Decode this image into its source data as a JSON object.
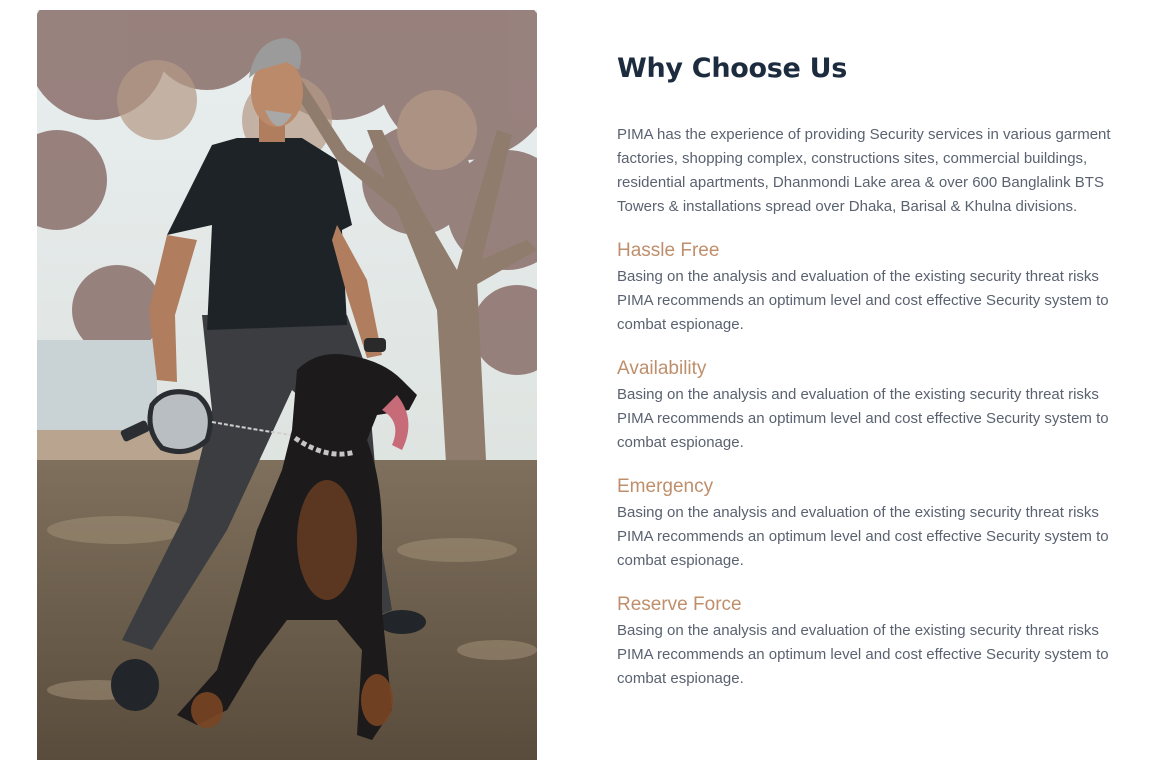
{
  "section": {
    "title": "Why Choose Us",
    "intro": "PIMA has the experience of providing Security services in various garment factories, shopping complex, constructions sites, commercial buildings, residential apartments, Dhanmondi Lake area & over 600 Banglalink BTS Towers & installations spread over Dhaka, Barisal & Khulna divisions."
  },
  "features": [
    {
      "title": "Hassle Free",
      "text": "Basing on the analysis and evaluation of the existing security threat risks PIMA recommends an optimum level and cost effective Security system to combat espionage."
    },
    {
      "title": "Availability",
      "text": "Basing on the analysis and evaluation of the existing security threat risks PIMA recommends an optimum level and cost effective Security system to combat espionage."
    },
    {
      "title": "Emergency",
      "text": "Basing on the analysis and evaluation of the existing security threat risks PIMA recommends an optimum level and cost effective Security system to combat espionage."
    },
    {
      "title": "Reserve Force",
      "text": "Basing on the analysis and evaluation of the existing security threat risks PIMA recommends an optimum level and cost effective Security system to combat espionage."
    }
  ],
  "colors": {
    "heading": "#1c2b3d",
    "accent": "#bf8f6c",
    "body_text": "#5a6270"
  }
}
